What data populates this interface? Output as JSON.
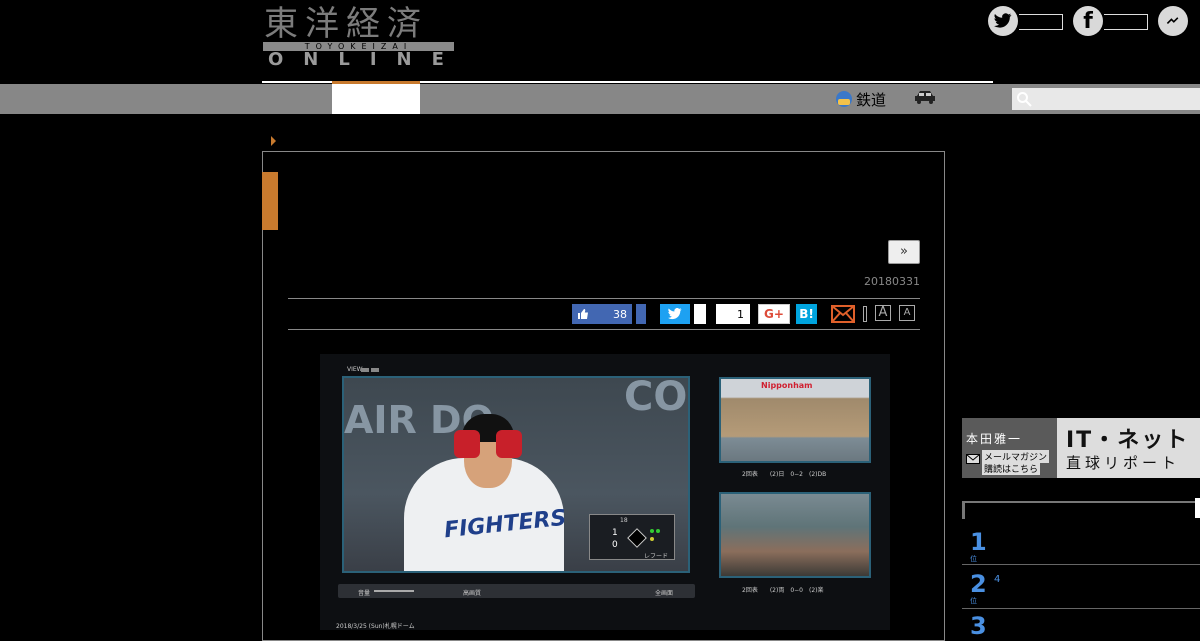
{
  "header": {
    "logo_kanji": "東洋経済",
    "logo_band": "TOYOKEIZAI",
    "logo_online": "ONLINE",
    "social": [
      "twitter-icon",
      "facebook-icon",
      "messenger-icon"
    ]
  },
  "nav": {
    "rail_label": "鉄道",
    "search_placeholder": ""
  },
  "article": {
    "more_label": "»",
    "date": "20180331",
    "share": {
      "like_count": "38",
      "share_count": "1",
      "gplus_label": "G+",
      "hatena_label": "B!",
      "font_large": "A",
      "font_small": "A"
    }
  },
  "broadcast": {
    "view_label": "VIEW",
    "sub1_caption": "2回表　　(2)日　0−2　(2)DB",
    "sub2_caption": "2回表　　(2)両　0−0　(2)楽",
    "sub1_banner": "Nipponham",
    "ctrl_volume": "音量",
    "ctrl_quality": "高画質",
    "ctrl_fullscreen": "全画面",
    "bottom_text": "2018/3/25 (Sun)札幌ドーム",
    "score_label": "レフード",
    "score_pitch": "18",
    "score_top": "1",
    "score_bottom": "0",
    "main_sign": "AIR DO",
    "main_sign_right": "CO",
    "jersey_text": "FIGHTERS"
  },
  "sidebar": {
    "ad": {
      "name": "本田雅一",
      "line1": "メールマガジン",
      "line2": "購読はこちら",
      "title": "IT・ネット",
      "subtitle": "直球リポート"
    },
    "ranking": [
      {
        "num": "1",
        "sub": "位",
        "text": ""
      },
      {
        "num": "2",
        "sub": "位",
        "text": "4"
      },
      {
        "num": "3",
        "sub": "",
        "text": ""
      }
    ]
  }
}
